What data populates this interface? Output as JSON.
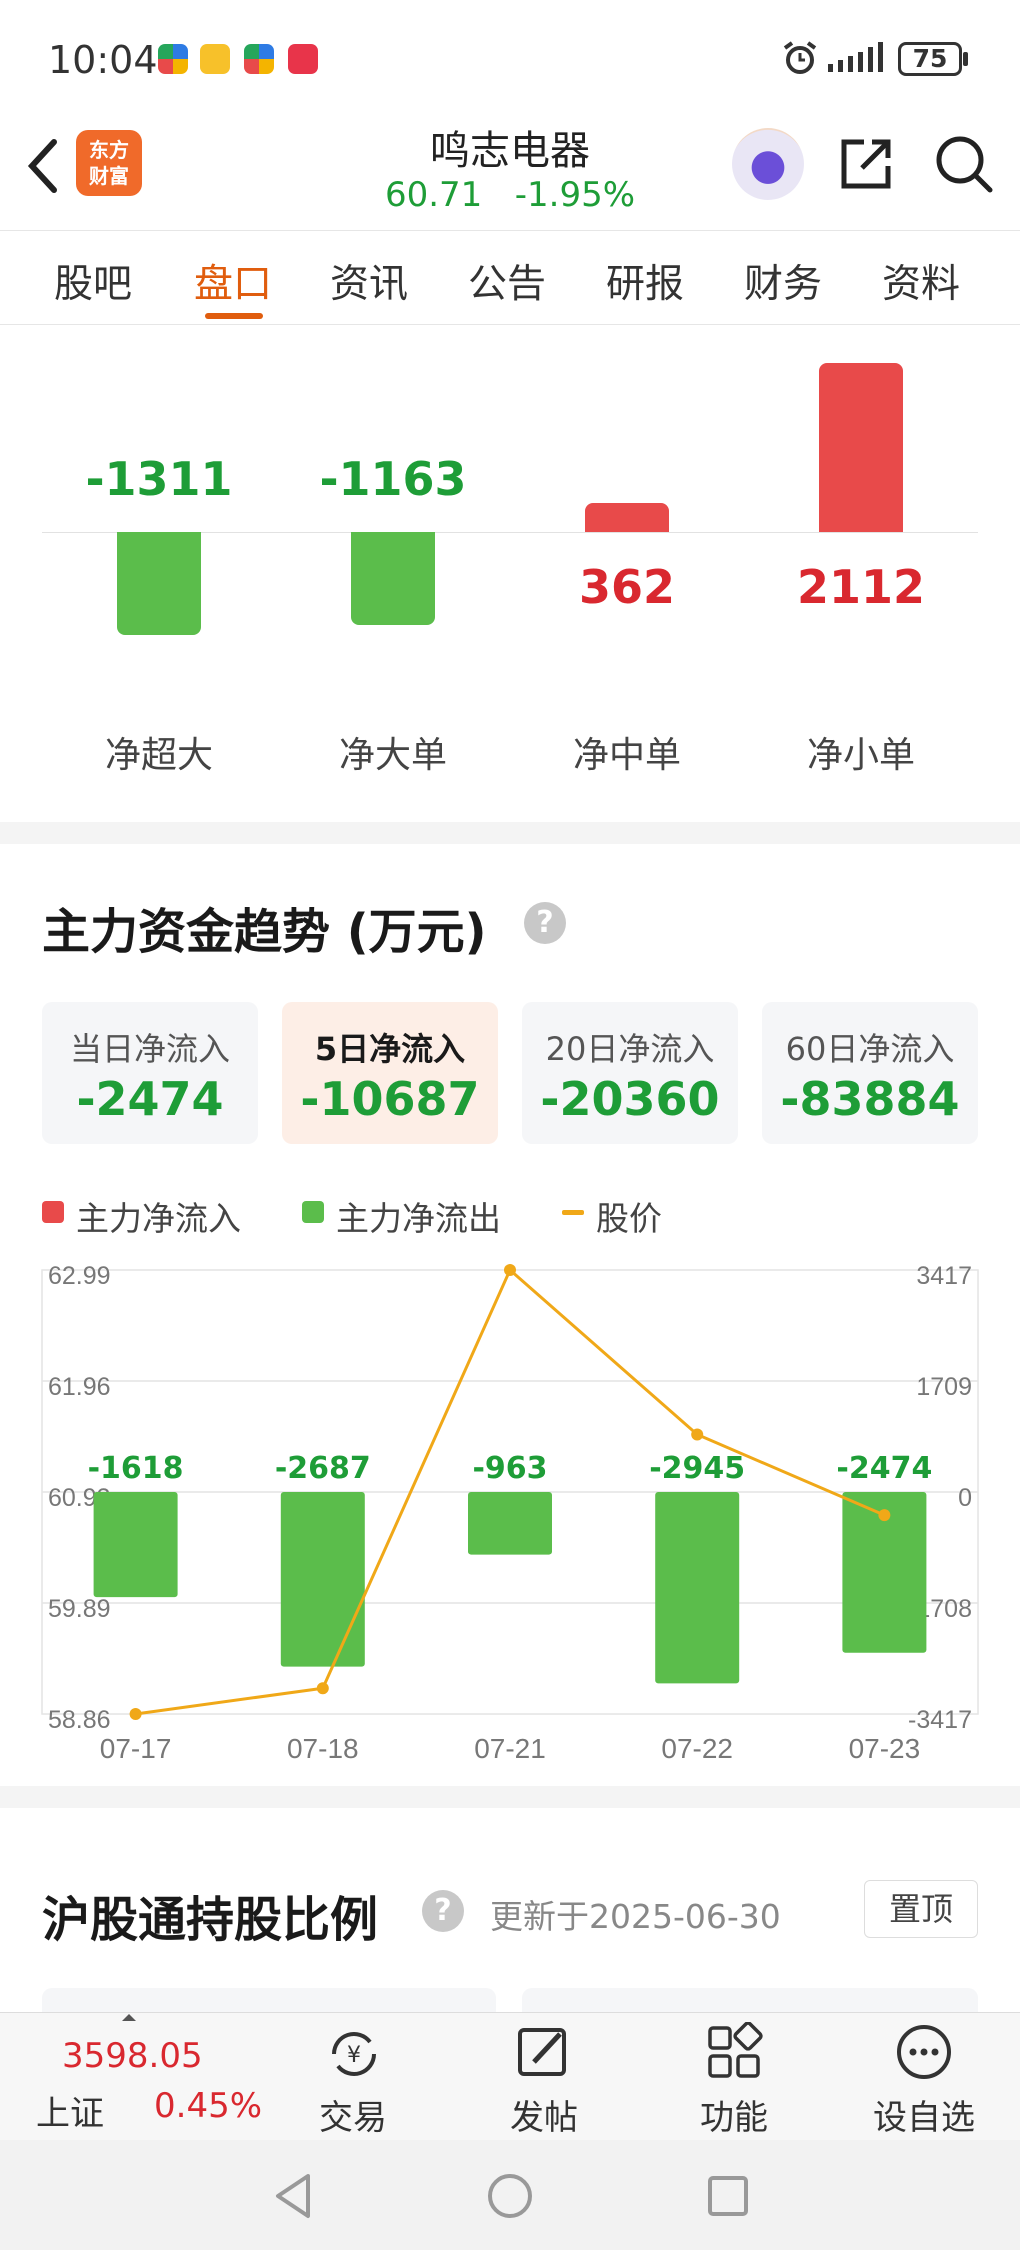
{
  "status_bar": {
    "time": "10:04",
    "battery": "75"
  },
  "header": {
    "logo_text_1": "东方",
    "logo_text_2": "财富",
    "stock_name": "鸣志电器",
    "price": "60.71",
    "change_pct": "-1.95%",
    "colors": {
      "up": "#d9282f",
      "down": "#1e9d37",
      "accent": "#e05d0e"
    }
  },
  "tabs": [
    {
      "label": "股吧"
    },
    {
      "label": "盘口",
      "active": true
    },
    {
      "label": "资讯"
    },
    {
      "label": "公告"
    },
    {
      "label": "研报"
    },
    {
      "label": "财务"
    },
    {
      "label": "资料"
    }
  ],
  "net_flow": {
    "items": [
      {
        "label": "净超大",
        "value": "-1311"
      },
      {
        "label": "净大单",
        "value": "-1163"
      },
      {
        "label": "净中单",
        "value": "362"
      },
      {
        "label": "净小单",
        "value": "2112"
      }
    ]
  },
  "trend": {
    "title": "主力资金趋势 (万元)",
    "help": "?",
    "cards": [
      {
        "label": "当日净流入",
        "value": "-2474"
      },
      {
        "label": "5日净流入",
        "value": "-10687",
        "selected": true
      },
      {
        "label": "20日净流入",
        "value": "-20360"
      },
      {
        "label": "60日净流入",
        "value": "-83884"
      }
    ],
    "legend": [
      {
        "label": "主力净流入",
        "color": "#e84a4a"
      },
      {
        "label": "主力净流出",
        "color": "#5bbd4b"
      },
      {
        "label": "股价",
        "color": "#f0a818"
      }
    ]
  },
  "chart_data": {
    "type": "bar",
    "categories": [
      "07-17",
      "07-18",
      "07-21",
      "07-22",
      "07-23"
    ],
    "series": [
      {
        "values": [
          -1618,
          -2687,
          -963,
          -2945,
          -2474
        ]
      },
      {
        "values": [
          58.86,
          59.1,
          62.99,
          61.46,
          60.71
        ]
      }
    ],
    "left_ticks": [
      "62.99",
      "61.96",
      "60.93",
      "59.89",
      "58.86"
    ],
    "right_ticks": [
      "3417",
      "1709",
      "0",
      "-1708",
      "-3417"
    ],
    "ylim_left": [
      58.86,
      62.99
    ],
    "ylim_right": [
      -3417,
      3417
    ],
    "grid": true
  },
  "hsgt": {
    "title": "沪股通持股比例",
    "help": "?",
    "updated": "更新于2025-06-30",
    "pin_button": "置顶"
  },
  "bottom_nav": {
    "index_value": "3598.05",
    "index_name": "上证",
    "index_change": "0.45%",
    "items": [
      {
        "label": "交易",
        "icon": "yuan-cycle-icon"
      },
      {
        "label": "发帖",
        "icon": "edit-icon"
      },
      {
        "label": "功能",
        "icon": "grid-icon"
      },
      {
        "label": "设自选",
        "icon": "more-icon"
      }
    ]
  }
}
